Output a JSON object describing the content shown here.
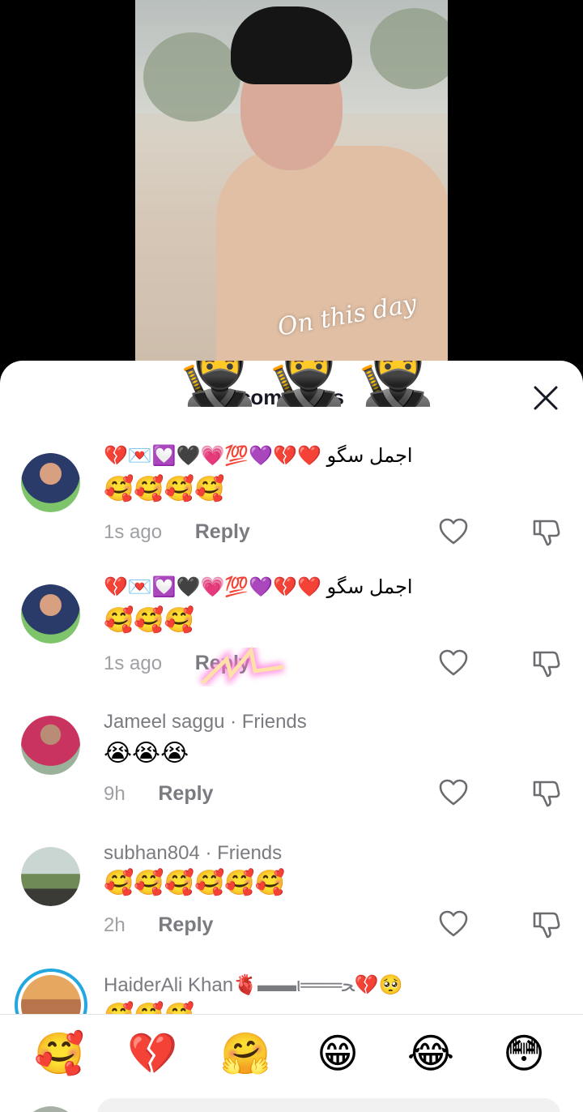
{
  "video": {
    "overlay_text": "On this day"
  },
  "sheet": {
    "title": "comments"
  },
  "comments": [
    {
      "author": "",
      "text_rtl": "اجمل سگو ❤️💔💜💯💗🖤💟💌💔",
      "text": "🥰🥰🥰🥰",
      "time": "1s ago",
      "reply": "Reply"
    },
    {
      "author": "",
      "text_rtl": "اجمل سگو ❤️💔💜💯💗🖤💟💌💔",
      "text": "🥰🥰🥰",
      "time": "1s ago",
      "reply": "Reply"
    },
    {
      "author": "Jameel saggu · Friends",
      "text": "😭😭😭",
      "time": "9h",
      "reply": "Reply"
    },
    {
      "author": "subhan804 · Friends",
      "text": "🥰🥰🥰🥰🥰🥰",
      "time": "2h",
      "reply": "Reply"
    },
    {
      "author": "HaiderAli Khan🫀▬▬ι═══ﺤ💔🥺",
      "text": "🥰🥰🥰"
    }
  ],
  "emoji_bar": [
    "🥰",
    "💔",
    "🤗",
    "😁",
    "😂",
    "😳"
  ],
  "colors": {
    "accent_ring": "#22a7e0",
    "text_muted": "#7a7b80"
  }
}
